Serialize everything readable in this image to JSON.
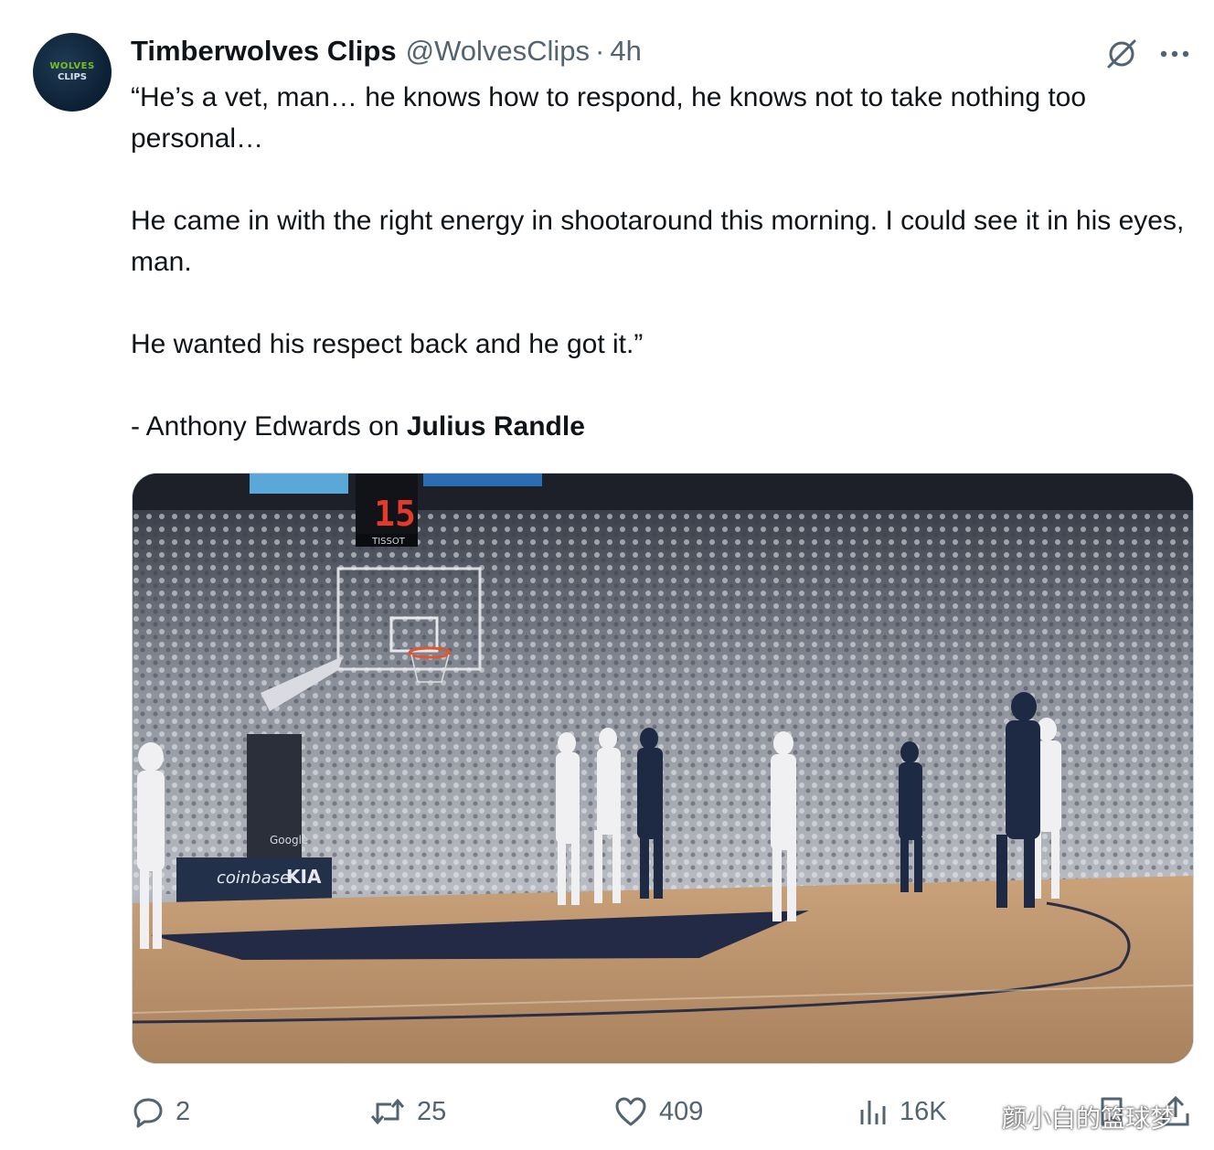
{
  "tweet": {
    "author": {
      "display_name": "Timberwolves Clips",
      "handle": "@WolvesClips",
      "separator": "·",
      "time": "4h",
      "avatar_text_1": "WOLVES",
      "avatar_text_2": "CLIPS"
    },
    "text": {
      "line1": "“He’s a vet, man… he knows how to respond, he knows not to take nothing too personal…",
      "line2": "He came in with the right energy in shootaround this morning. I could see it in his eyes, man.",
      "line3": "He wanted his respect back and he got it.”",
      "attribution_prefix": "- Anthony Edwards on ",
      "attribution_name": "Julius Randle"
    },
    "media": {
      "shot_clock": "15",
      "tissot": "TISSOT",
      "coinbase": "coinbase",
      "kia": "KIA",
      "google": "Google"
    },
    "actions": {
      "replies": "2",
      "reposts": "25",
      "likes": "409",
      "views": "16K"
    }
  },
  "watermark": "颜小白的篮球梦",
  "colors": {
    "text_primary": "#0f1419",
    "text_secondary": "#536471",
    "border": "#cfd9de"
  }
}
